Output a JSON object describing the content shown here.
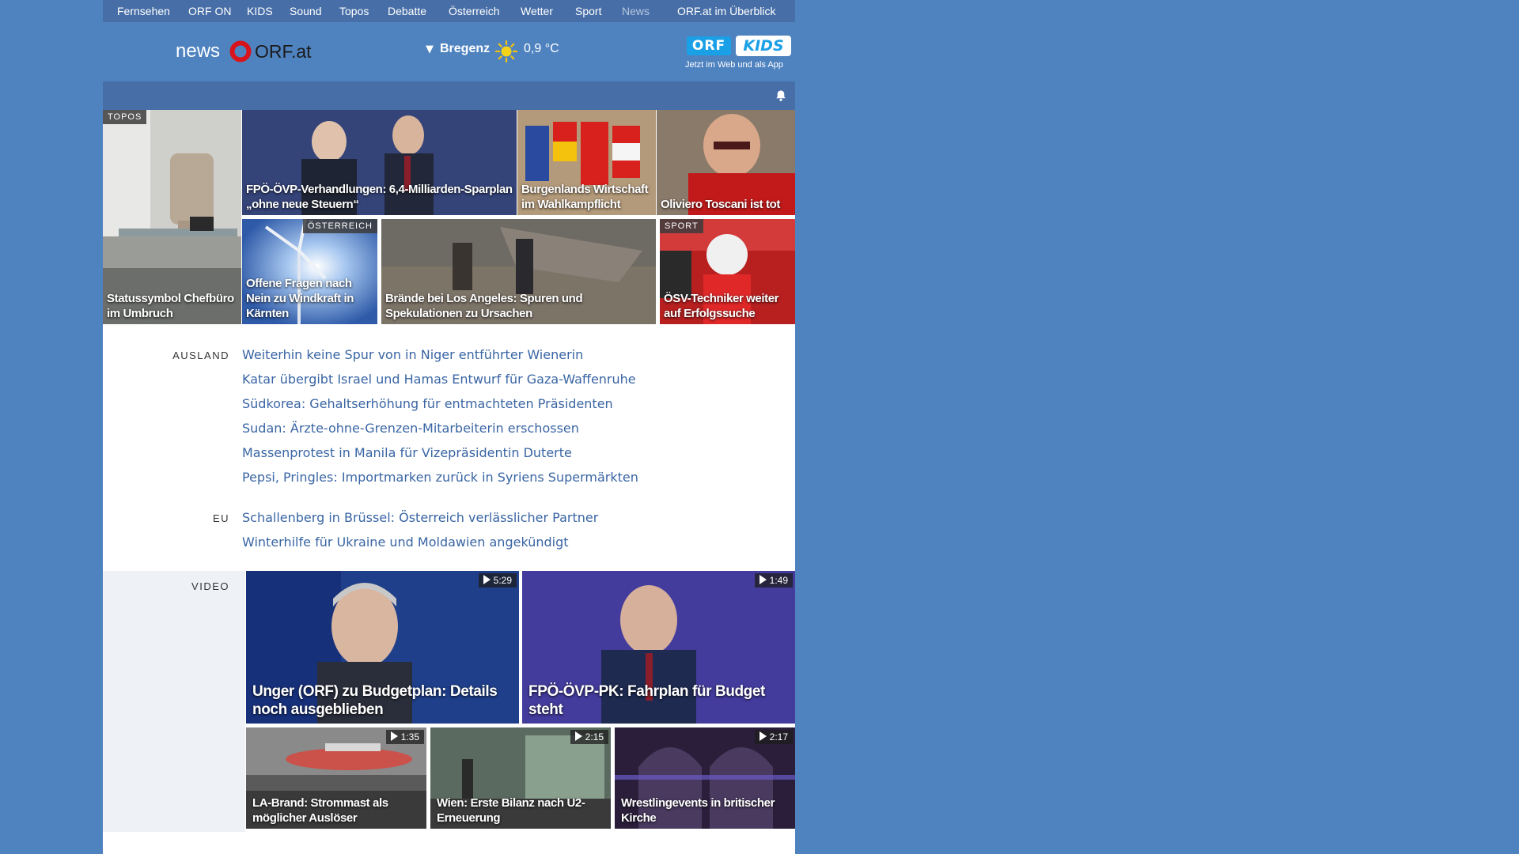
{
  "topnav": {
    "items": [
      "Fernsehen",
      "ORF ON",
      "KIDS",
      "Sound",
      "Topos",
      "Debatte",
      "Österreich",
      "Wetter",
      "Sport",
      "News"
    ],
    "overview": "ORF.at im Überblick"
  },
  "header": {
    "logo_news": "news",
    "logo_orf": "ORF.at",
    "weather": {
      "city": "Bregenz",
      "temperature": "0,9 °C",
      "icon": "sun-icon"
    },
    "kids": {
      "orf": "ORF",
      "kids": "KIDS",
      "tagline": "Jetzt im Web und als App"
    }
  },
  "tiles": [
    {
      "caption": "Statussymbol Chefbüro im Umbruch",
      "tag": "TOPOS"
    },
    {
      "caption": "FPÖ-ÖVP-Verhandlungen: 6,4-Milliarden-Sparplan „ohne neue Steuern“"
    },
    {
      "caption": "Burgenlands Wirtschaft im Wahlkampflicht"
    },
    {
      "caption": "Oliviero Toscani ist tot"
    },
    {
      "caption": "Offene Fragen nach Nein zu Windkraft in Kärnten",
      "tag": "ÖSTERREICH"
    },
    {
      "caption": "Brände bei Los Angeles: Spuren und Spekulationen zu Ursachen"
    },
    {
      "caption": "ÖSV-Techniker weiter auf Erfolgssuche",
      "tag": "SPORT"
    }
  ],
  "sections": {
    "ausland": {
      "label": "AUSLAND",
      "headlines": [
        "Weiterhin keine Spur von in Niger entführter Wienerin",
        "Katar übergibt Israel und Hamas Entwurf für Gaza-Waffenruhe",
        "Südkorea: Gehaltserhöhung für entmachteten Präsidenten",
        "Sudan: Ärzte-ohne-Grenzen-Mitarbeiterin erschossen",
        "Massenprotest in Manila für Vizepräsidentin Duterte",
        "Pepsi, Pringles: Importmarken zurück in Syriens Supermärkten"
      ]
    },
    "eu": {
      "label": "EU",
      "headlines": [
        "Schallenberg in Brüssel: Österreich verlässlicher Partner",
        "Winterhilfe für Ukraine und Moldawien angekündigt"
      ]
    },
    "video": {
      "label": "VIDEO",
      "items": [
        {
          "caption": "Unger (ORF) zu Budgetplan: Details noch ausgeblieben",
          "duration": "5:29"
        },
        {
          "caption": "FPÖ-ÖVP-PK: Fahrplan für Budget steht",
          "duration": "1:49"
        },
        {
          "caption": "LA-Brand: Strommast als möglicher Auslöser",
          "duration": "1:35"
        },
        {
          "caption": "Wien: Erste Bilanz nach U2-Erneuerung",
          "duration": "2:15"
        },
        {
          "caption": "Wrestlingevents in britischer Kirche",
          "duration": "2:17"
        }
      ]
    }
  },
  "colors": {
    "page_background": "#4f83c0",
    "nav_bar": "#476ea7",
    "headline_link": "#3965a4",
    "orf_red": "#d9131b"
  }
}
